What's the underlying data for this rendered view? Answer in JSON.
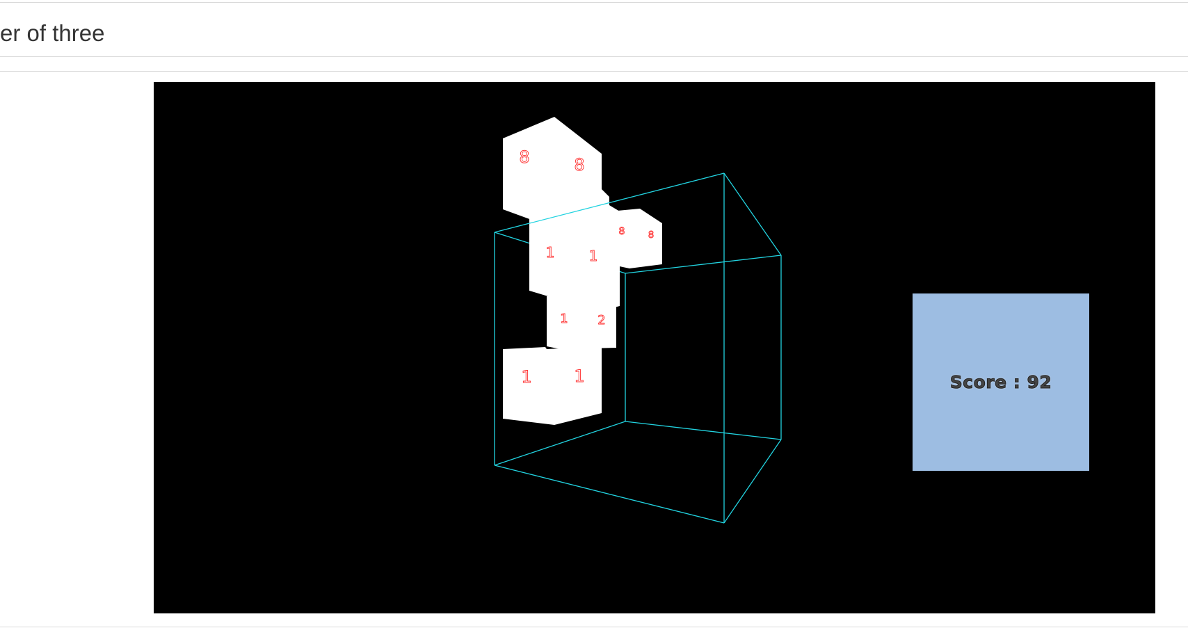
{
  "header": {
    "title": "er of three"
  },
  "game": {
    "score_label": "Score : 92",
    "colors": {
      "background": "#000000",
      "wireframe": "#22d3e0",
      "cube_face": "#ffffff",
      "cube_number": "#ff3030",
      "score_panel": "#9dbde2"
    },
    "cube_numbers": [
      {
        "face_a": "8",
        "face_b": "8"
      },
      {
        "face_a": "1",
        "face_b": "1"
      },
      {
        "face_a": "8",
        "face_b": "8"
      },
      {
        "face_a": "1",
        "face_b": "2"
      },
      {
        "face_a": "1",
        "face_b": "1"
      }
    ]
  }
}
